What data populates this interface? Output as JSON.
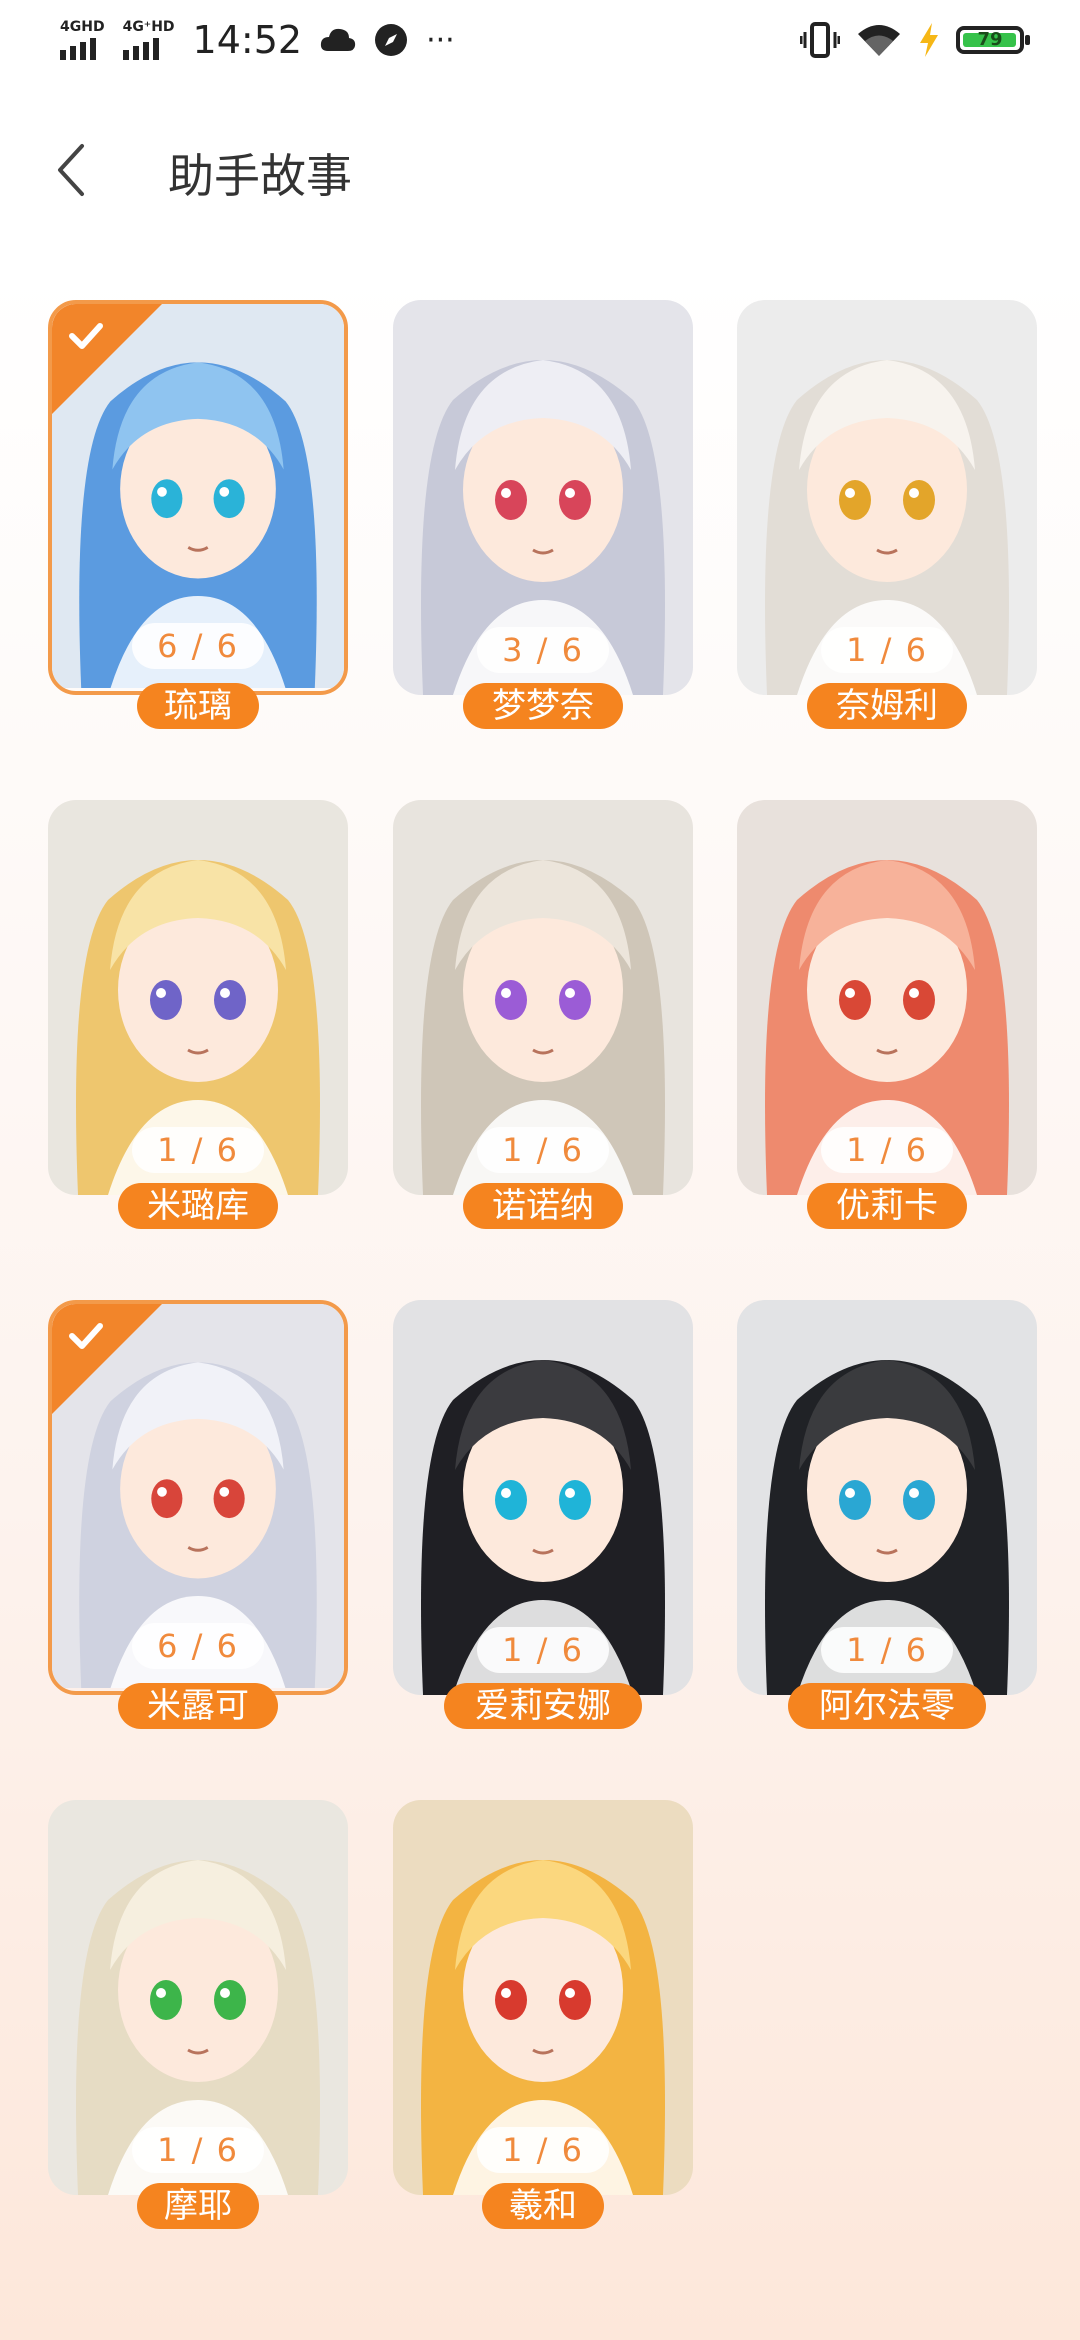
{
  "status": {
    "sig1_label": "4GHD",
    "sig2_label": "4G⁺HD",
    "time": "14:52",
    "more": "···",
    "battery": "79"
  },
  "header": {
    "title": "助手故事"
  },
  "assistants": [
    {
      "name": "琉璃",
      "count": "6 / 6",
      "selected": true
    },
    {
      "name": "梦梦奈",
      "count": "3 / 6",
      "selected": false
    },
    {
      "name": "奈姆利",
      "count": "1 / 6",
      "selected": false
    },
    {
      "name": "米璐库",
      "count": "1 / 6",
      "selected": false
    },
    {
      "name": "诺诺纳",
      "count": "1 / 6",
      "selected": false
    },
    {
      "name": "优莉卡",
      "count": "1 / 6",
      "selected": false
    },
    {
      "name": "米露可",
      "count": "6 / 6",
      "selected": true
    },
    {
      "name": "爱莉安娜",
      "count": "1 / 6",
      "selected": false
    },
    {
      "name": "阿尔法零",
      "count": "1 / 6",
      "selected": false
    },
    {
      "name": "摩耶",
      "count": "1 / 6",
      "selected": false
    },
    {
      "name": "羲和",
      "count": "1 / 6",
      "selected": false
    }
  ],
  "colors": {
    "accent": "#f5841f",
    "selected_border": "#f39a4a"
  },
  "icons": [
    "signal-icon",
    "cloud-icon",
    "compass-icon",
    "vibrate-icon",
    "wifi-icon",
    "charging-icon",
    "battery-icon",
    "back-arrow-icon",
    "check-icon"
  ]
}
